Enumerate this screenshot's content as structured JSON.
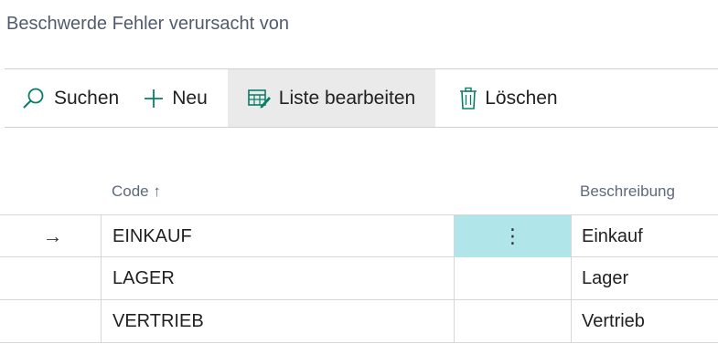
{
  "page": {
    "title": "Beschwerde Fehler verursacht von"
  },
  "toolbar": {
    "search_label": "Suchen",
    "new_label": "Neu",
    "edit_list_label": "Liste bearbeiten",
    "delete_label": "Löschen"
  },
  "table": {
    "columns": {
      "code": "Code ↑",
      "description": "Beschreibung"
    },
    "rows": [
      {
        "indicator": "→",
        "code": "EINKAUF",
        "menu": "⋮",
        "description": "Einkauf"
      },
      {
        "indicator": "",
        "code": "LAGER",
        "menu": "",
        "description": "Lager"
      },
      {
        "indicator": "",
        "code": "VERTRIEB",
        "menu": "",
        "description": "Vertrieb"
      }
    ]
  },
  "colors": {
    "accent": "#00a37e",
    "selected_cell": "#b0e5ea",
    "active_button_bg": "#eaeaea"
  }
}
